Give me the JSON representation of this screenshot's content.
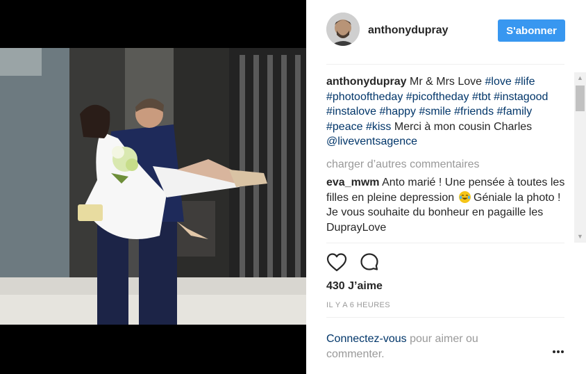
{
  "header": {
    "username": "anthonydupray",
    "follow_label": "S'abonner"
  },
  "caption": {
    "username": "anthonydupray",
    "text": "Mr & Mrs Love",
    "hashtags": [
      "#love",
      "#life",
      "#photooftheday",
      "#picoftheday",
      "#tbt",
      "#instagood",
      "#instalove",
      "#happy",
      "#smile",
      "#friends",
      "#family",
      "#peace",
      "#kiss"
    ],
    "trailing_text": "Merci à mon cousin Charles",
    "mention": "@liveventsagence"
  },
  "load_more_label": "charger d’autres commentaires",
  "comment": {
    "username": "eva_mwm",
    "text_before_emoji": "Anto marié ! Une pensée à toutes les filles en pleine depression",
    "emoji": "crying-laughing-face",
    "text_after_emoji": "Géniale la photo ! Je vous souhaite du bonheur en pagaille les DuprayLove"
  },
  "actions": {
    "like_icon": "heart-icon",
    "comment_icon": "comment-icon"
  },
  "likes_label": "430 J’aime",
  "timestamp": "IL Y A 6 HEURES",
  "login_prompt": {
    "link": "Connectez-vous",
    "text": "pour aimer ou commenter."
  },
  "more_icon": "more-options-icon",
  "colors": {
    "follow_button": "#3897f0",
    "link": "#003569",
    "muted": "#999999",
    "text": "#262626"
  }
}
